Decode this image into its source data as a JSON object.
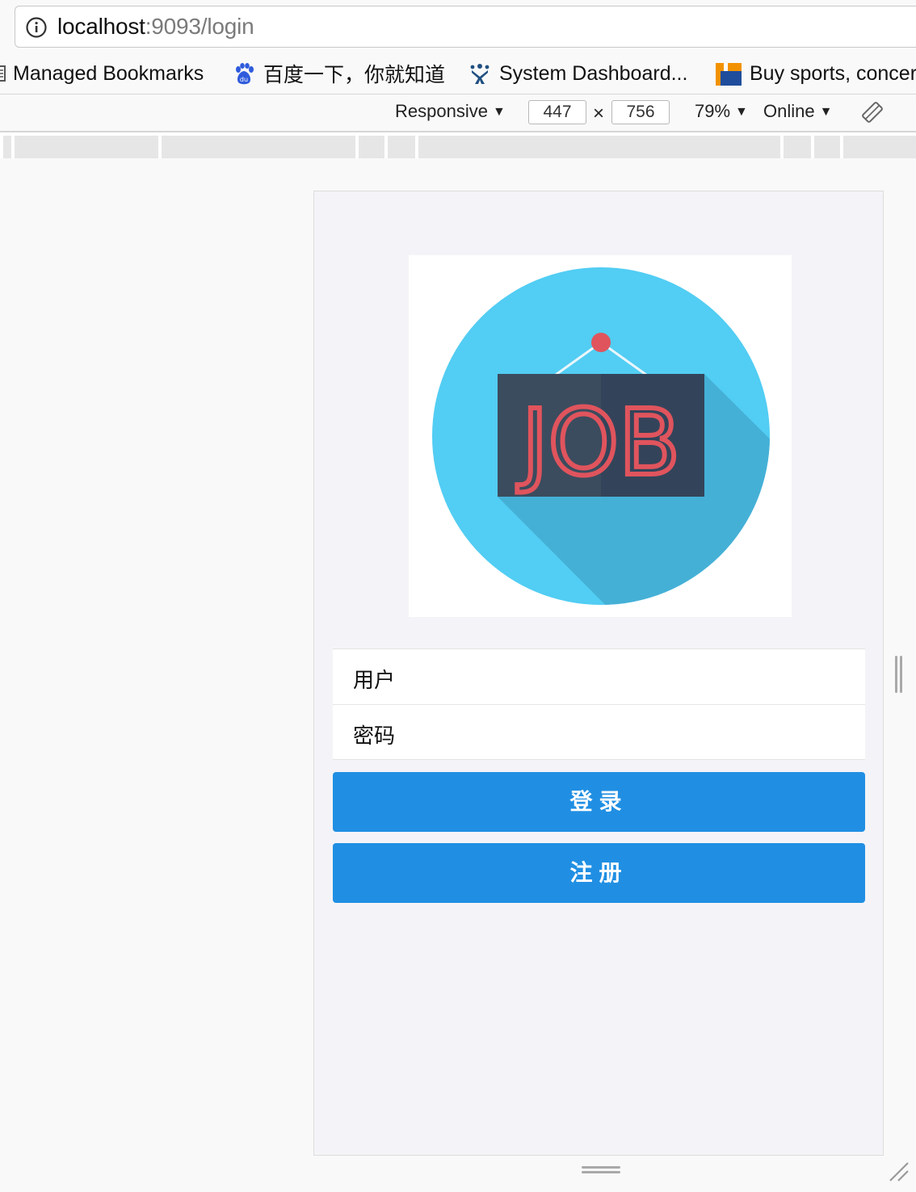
{
  "address_bar": {
    "url_host": "localhost",
    "url_rest": ":9093/login"
  },
  "bookmarks": [
    {
      "label": "Managed Bookmarks",
      "icon": "folder-icon"
    },
    {
      "label": "百度一下，你就知道",
      "icon": "baidu-paw-icon"
    },
    {
      "label": "System Dashboard...",
      "icon": "jira-icon"
    },
    {
      "label": "Buy sports, concer",
      "icon": "ticket-icon"
    }
  ],
  "device_toolbar": {
    "mode": "Responsive",
    "width": "447",
    "height": "756",
    "separator": "×",
    "zoom": "79%",
    "throttle": "Online"
  },
  "page": {
    "logo_text": "JOB",
    "username_label": "用户",
    "password_label": "密码",
    "login_button": "登录",
    "register_button": "注册"
  },
  "colors": {
    "primary_button": "#208fe3",
    "logo_circle": "#52cdf3",
    "logo_shadow": "#45b0d6",
    "sign_board": "#3b4c5e",
    "sign_text": "#e0545d"
  }
}
